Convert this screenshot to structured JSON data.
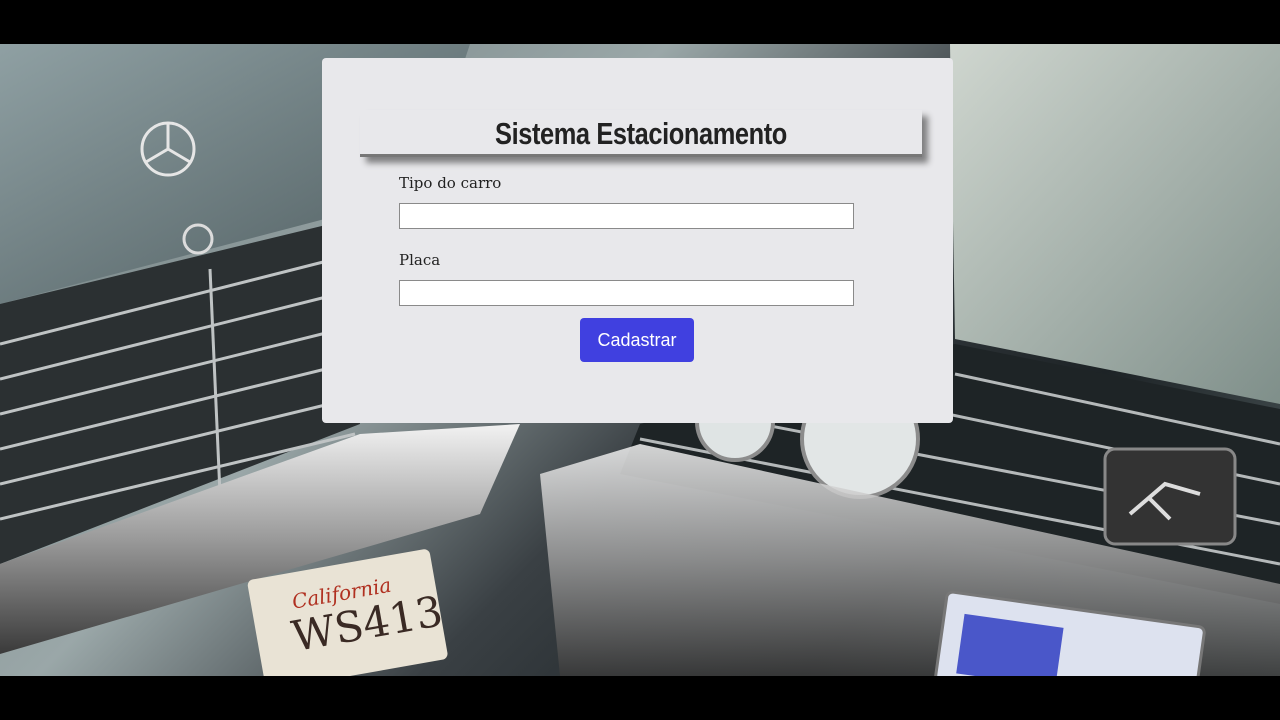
{
  "form": {
    "title": "Sistema Estacionamento",
    "fields": [
      {
        "label": "Tipo do carro",
        "value": "",
        "placeholder": ""
      },
      {
        "label": "Placa",
        "value": "",
        "placeholder": ""
      }
    ],
    "submit_label": "Cadastrar"
  },
  "colors": {
    "card_background": "#e8e8eb",
    "button_background": "#4040e0",
    "button_text": "#ffffff"
  },
  "background": {
    "plate_text": "California",
    "plate_number": "WS413"
  }
}
